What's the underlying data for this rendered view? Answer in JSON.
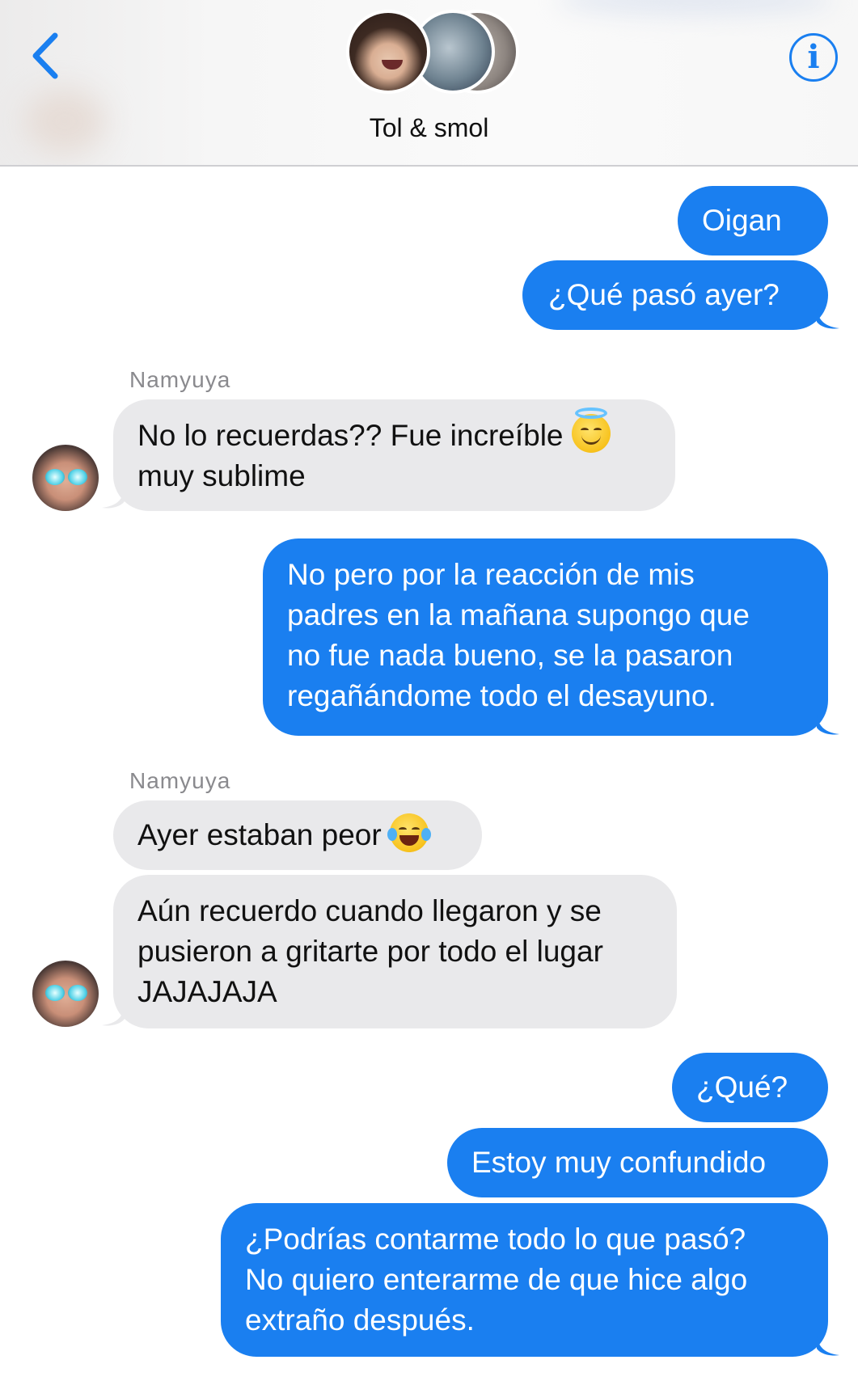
{
  "header": {
    "back_icon": "chevron-left-icon",
    "info_icon": "info-icon",
    "info_glyph": "i",
    "group_name": "Tol & smol"
  },
  "colors": {
    "accent": "#1a7ff0",
    "incoming_bubble": "#e9e9eb",
    "outgoing_bubble": "#1a7ff0",
    "sender_label": "#8a8a8e"
  },
  "messages": [
    {
      "direction": "outgoing",
      "lines": [
        "Oigan"
      ]
    },
    {
      "direction": "outgoing",
      "lines": [
        "¿Qué pasó ayer?"
      ]
    },
    {
      "direction": "incoming",
      "sender": "Namyuya",
      "lines": [
        "No lo recuerdas?? Fue increíble",
        "muy sublime"
      ],
      "emoji": "smiling-face-with-halo-icon"
    },
    {
      "direction": "outgoing",
      "lines": [
        "No pero por la reacción de mis",
        "padres en la mañana supongo que",
        "no fue nada bueno, se la pasaron",
        "regañándome todo el desayuno."
      ]
    },
    {
      "direction": "incoming",
      "sender": "Namyuya",
      "lines": [
        "Ayer estaban peor"
      ],
      "emoji": "face-with-tears-of-joy-icon"
    },
    {
      "direction": "incoming",
      "lines": [
        "Aún recuerdo cuando llegaron y se",
        "pusieron a gritarte por todo el lugar",
        "JAJAJAJA"
      ]
    },
    {
      "direction": "outgoing",
      "lines": [
        "¿Qué?"
      ]
    },
    {
      "direction": "outgoing",
      "lines": [
        "Estoy muy confundido"
      ]
    },
    {
      "direction": "outgoing",
      "lines": [
        "¿Podrías contarme todo lo que pasó?",
        "No quiero enterarme de que hice algo",
        "extraño después."
      ]
    }
  ]
}
